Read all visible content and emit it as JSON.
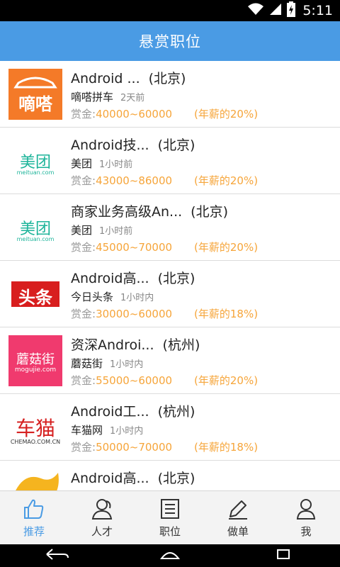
{
  "status_bar": {
    "time": "5:11"
  },
  "header": {
    "title": "悬赏职位"
  },
  "jobs": [
    {
      "title": "Android ...",
      "city": "(北京)",
      "company": "嘀嗒拼车",
      "time": "2天前",
      "reward_label": "赏金:",
      "reward": "40000~60000",
      "percent": "(年薪的20%)",
      "logo": {
        "text": "嘀嗒",
        "sub": "",
        "color": "#ffffff",
        "bg": "#f47a28",
        "icon": "dida-car-icon"
      }
    },
    {
      "title": "Android技...",
      "city": "(北京)",
      "company": "美团",
      "time": "1小时前",
      "reward_label": "赏金:",
      "reward": "43000~86000",
      "percent": "(年薪的20%)",
      "logo": {
        "text": "美团",
        "sub": "meituan.com",
        "color": "#1db49a",
        "bg": "#ffffff"
      }
    },
    {
      "title": "商家业务高级An...",
      "city": "(北京)",
      "company": "美团",
      "time": "1小时前",
      "reward_label": "赏金:",
      "reward": "45000~70000",
      "percent": "(年薪的20%)",
      "logo": {
        "text": "美团",
        "sub": "meituan.com",
        "color": "#1db49a",
        "bg": "#ffffff"
      }
    },
    {
      "title": "Android高...",
      "city": "(北京)",
      "company": "今日头条",
      "time": "1小时内",
      "reward_label": "赏金:",
      "reward": "30000~60000",
      "percent": "(年薪的18%)",
      "logo": {
        "text": "头条",
        "sub": "",
        "color": "#ffffff",
        "bg": "#d81e1e"
      }
    },
    {
      "title": "资深Androi...",
      "city": "(杭州)",
      "company": "蘑菇街",
      "time": "1小时内",
      "reward_label": "赏金:",
      "reward": "55000~60000",
      "percent": "(年薪的20%)",
      "logo": {
        "text": "蘑菇街",
        "sub": "mogujie.com",
        "color": "#ffffff",
        "bg": "#f03a6e"
      }
    },
    {
      "title": "Android工...",
      "city": "(杭州)",
      "company": "车猫网",
      "time": "1小时内",
      "reward_label": "赏金:",
      "reward": "50000~70000",
      "percent": "(年薪的18%)",
      "logo": {
        "text": "车猫",
        "sub": "CHEMAO.COM.CN",
        "color": "#d62020",
        "bg": "#ffffff"
      }
    },
    {
      "title": "Android高...",
      "city": "(北京)",
      "company": "",
      "time": "",
      "reward_label": "",
      "reward": "",
      "percent": "",
      "logo": {
        "text": "",
        "sub": "",
        "color": "#ffffff",
        "bg": "#ffffff",
        "icon": "flame-logo-icon"
      }
    }
  ],
  "bottom_nav": [
    {
      "label": "推荐",
      "icon": "thumbs-up-icon",
      "active": true
    },
    {
      "label": "人才",
      "icon": "people-icon",
      "active": false
    },
    {
      "label": "职位",
      "icon": "list-icon",
      "active": false
    },
    {
      "label": "做单",
      "icon": "edit-icon",
      "active": false
    },
    {
      "label": "我",
      "icon": "person-icon",
      "active": false
    }
  ],
  "colors": {
    "accent": "#4a9be4",
    "reward": "#f6a53a",
    "muted": "#9a9a9a"
  }
}
